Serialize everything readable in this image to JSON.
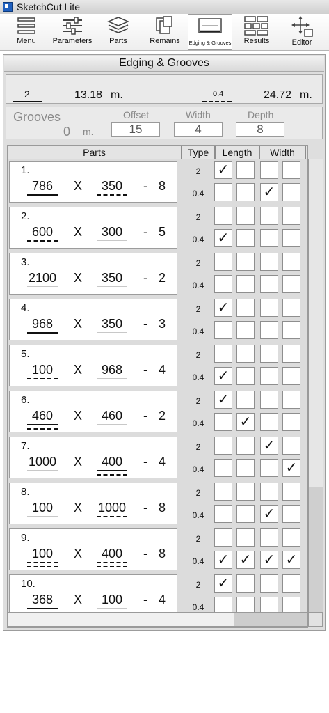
{
  "window": {
    "title": "SketchCut Lite"
  },
  "toolbar": {
    "items": [
      {
        "label": "Menu",
        "icon": "menu-icon"
      },
      {
        "label": "Parameters",
        "icon": "sliders-icon"
      },
      {
        "label": "Parts",
        "icon": "layers-icon"
      },
      {
        "label": "Remains",
        "icon": "sheets-icon"
      },
      {
        "label": "Edging & Grooves",
        "icon": "edging-icon",
        "active": true
      },
      {
        "label": "Results",
        "icon": "grid-icon"
      },
      {
        "label": "Editor",
        "icon": "move-icon"
      }
    ]
  },
  "panel": {
    "title": "Edging & Grooves"
  },
  "summary": {
    "edge1_type": "2",
    "edge1_length": "13.18",
    "edge1_unit": "m.",
    "edge2_type": "0.4",
    "edge2_length": "24.72",
    "edge2_unit": "m."
  },
  "grooves": {
    "title": "Grooves",
    "total": "0",
    "unit": "m.",
    "offset_label": "Offset",
    "offset_value": "15",
    "width_label": "Width",
    "width_value": "4",
    "depth_label": "Depth",
    "depth_value": "8"
  },
  "table": {
    "headers": {
      "parts": "Parts",
      "type": "Type",
      "length": "Length",
      "width": "Width"
    },
    "type_labels": [
      "2",
      "0.4"
    ],
    "check_glyph": "✓",
    "rows": [
      {
        "num": "1.",
        "length": "786",
        "width": "350",
        "qty": "8",
        "len_edge": "solid",
        "wid_edge": "dash",
        "checks": [
          [
            true,
            false,
            false,
            false
          ],
          [
            false,
            false,
            true,
            false
          ]
        ]
      },
      {
        "num": "2.",
        "length": "600",
        "width": "300",
        "qty": "5",
        "len_edge": "dash",
        "wid_edge": "none",
        "checks": [
          [
            false,
            false,
            false,
            false
          ],
          [
            true,
            false,
            false,
            false
          ]
        ]
      },
      {
        "num": "3.",
        "length": "2100",
        "width": "350",
        "qty": "2",
        "len_edge": "none",
        "wid_edge": "none",
        "checks": [
          [
            false,
            false,
            false,
            false
          ],
          [
            false,
            false,
            false,
            false
          ]
        ]
      },
      {
        "num": "4.",
        "length": "968",
        "width": "350",
        "qty": "3",
        "len_edge": "solid",
        "wid_edge": "none",
        "checks": [
          [
            true,
            false,
            false,
            false
          ],
          [
            false,
            false,
            false,
            false
          ]
        ]
      },
      {
        "num": "5.",
        "length": "100",
        "width": "968",
        "qty": "4",
        "len_edge": "dash",
        "wid_edge": "none",
        "checks": [
          [
            false,
            false,
            false,
            false
          ],
          [
            true,
            false,
            false,
            false
          ]
        ]
      },
      {
        "num": "6.",
        "length": "460",
        "width": "460",
        "qty": "2",
        "len_edge": "solid-dash",
        "wid_edge": "none",
        "checks": [
          [
            true,
            false,
            false,
            false
          ],
          [
            false,
            true,
            false,
            false
          ]
        ]
      },
      {
        "num": "7.",
        "length": "1000",
        "width": "400",
        "qty": "4",
        "len_edge": "none",
        "wid_edge": "solid-dash",
        "checks": [
          [
            false,
            false,
            true,
            false
          ],
          [
            false,
            false,
            false,
            true
          ]
        ]
      },
      {
        "num": "8.",
        "length": "100",
        "width": "1000",
        "qty": "8",
        "len_edge": "none",
        "wid_edge": "dash",
        "checks": [
          [
            false,
            false,
            false,
            false
          ],
          [
            false,
            false,
            true,
            false
          ]
        ]
      },
      {
        "num": "9.",
        "length": "100",
        "width": "400",
        "qty": "8",
        "len_edge": "dash-dash",
        "wid_edge": "dash-dash",
        "checks": [
          [
            false,
            false,
            false,
            false
          ],
          [
            true,
            true,
            true,
            true
          ]
        ]
      },
      {
        "num": "10.",
        "length": "368",
        "width": "100",
        "qty": "4",
        "len_edge": "solid",
        "wid_edge": "none",
        "checks": [
          [
            true,
            false,
            false,
            false
          ],
          [
            false,
            false,
            false,
            false
          ]
        ]
      }
    ]
  }
}
